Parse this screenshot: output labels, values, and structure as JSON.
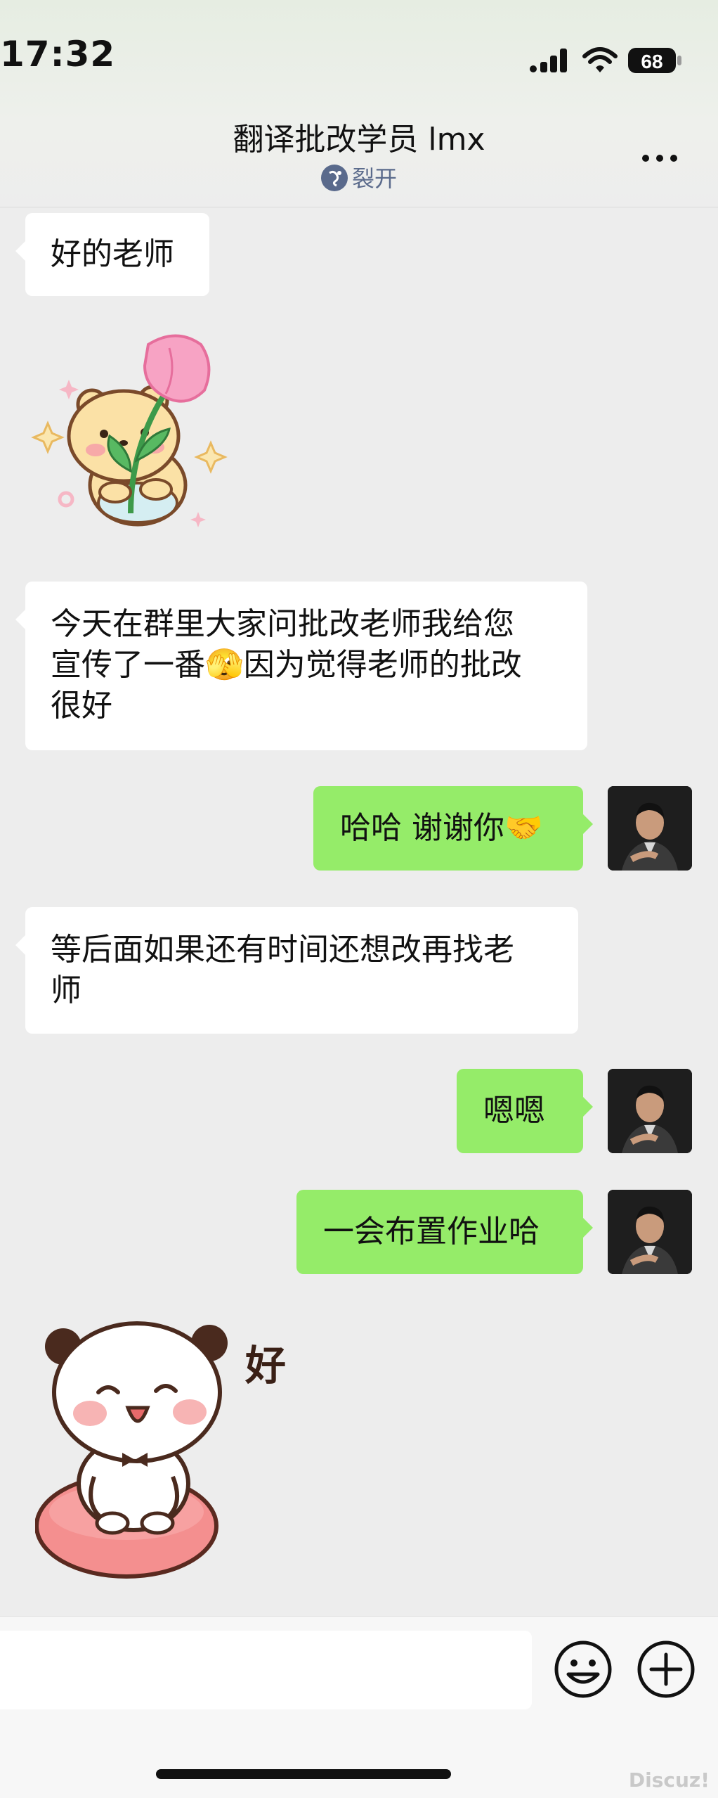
{
  "status_bar": {
    "time": "17:32",
    "battery": "68",
    "icons": [
      "signal-icon",
      "wifi-icon",
      "battery-icon"
    ]
  },
  "header": {
    "title": "翻译批改学员 lmx",
    "subtitle": "裂开",
    "icons": [
      "status-icon",
      "more-icon"
    ]
  },
  "messages": [
    {
      "side": "in",
      "type": "text",
      "text": "好的老师"
    },
    {
      "side": "in",
      "type": "sticker",
      "sticker": "bear-with-tulip-sticker"
    },
    {
      "side": "in",
      "type": "text",
      "lines": [
        "今天在群里大家问批改老师我给您",
        "宣传了一番🫣因为觉得老师的批改",
        "很好"
      ]
    },
    {
      "side": "out",
      "type": "text",
      "text": "哈哈 谢谢你🤝"
    },
    {
      "side": "in",
      "type": "text",
      "lines": [
        "等后面如果还有时间还想改再找老",
        "师"
      ]
    },
    {
      "side": "out",
      "type": "text",
      "text": "嗯嗯"
    },
    {
      "side": "out",
      "type": "text",
      "text": "一会布置作业哈"
    },
    {
      "side": "in",
      "type": "sticker",
      "sticker": "panda-saying-ok-sticker",
      "sticker_text": "好"
    }
  ],
  "input": {
    "value": "",
    "icons": [
      "emoji-icon",
      "plus-icon"
    ]
  },
  "watermark": "Discuz!",
  "colors": {
    "outgoing_bubble": "#95ec69",
    "incoming_bubble": "#ffffff",
    "background": "#ededed"
  }
}
